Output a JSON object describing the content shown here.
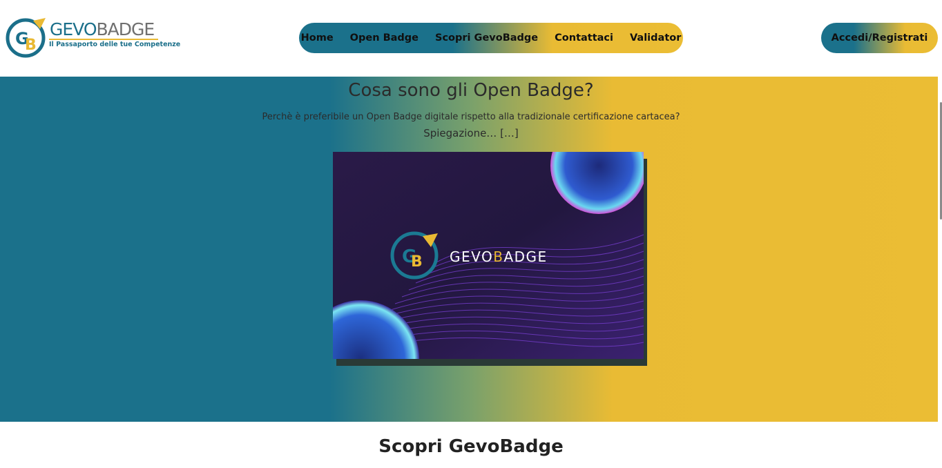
{
  "brand": {
    "name_part1": "GEVO",
    "name_part2": "BADGE",
    "tagline": "Il Passaporto delle tue Competenze",
    "logo_initials": "GB"
  },
  "nav": {
    "items": [
      {
        "label": "Home"
      },
      {
        "label": "Open Badge"
      },
      {
        "label": "Scopri GevoBadge"
      },
      {
        "label": "Contattaci"
      },
      {
        "label": "Validator"
      }
    ]
  },
  "header": {
    "login_label": "Accedi/Registrati"
  },
  "hero": {
    "title": "Cosa sono gli Open Badge?",
    "subtitle": "Perchè è preferibile un Open Badge digitale rispetto alla tradizionale certificazione cartacea?",
    "more_text": "Spiegazione… […]",
    "video_brand_part1": "GEVO",
    "video_brand_part2": "B",
    "video_brand_part3": "ADGE"
  },
  "section": {
    "title": "Scopri GevoBadge"
  },
  "colors": {
    "teal": "#1b718b",
    "gold": "#e9bb34",
    "video_bg": "#2a1d52"
  }
}
